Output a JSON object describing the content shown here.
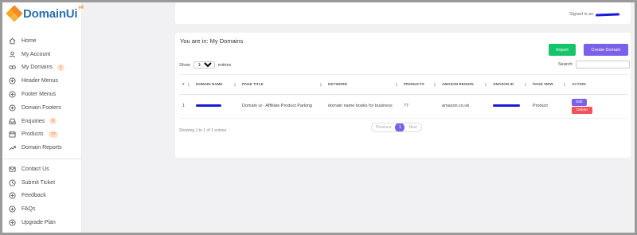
{
  "app": {
    "brand": "DomainUi",
    "brand_version": "v4",
    "colors": {
      "accent": "#7b61e8",
      "success": "#16c46b",
      "danger": "#f0535a",
      "brand_blue": "#2a6fb0",
      "brand_orange": "#f28c28"
    }
  },
  "sidebar": {
    "items": [
      {
        "label": "Home",
        "icon": "home-icon"
      },
      {
        "label": "My Account",
        "icon": "user-icon"
      },
      {
        "label": "My Domains",
        "icon": "link-icon",
        "badge": "1"
      },
      {
        "label": "Header Menus",
        "icon": "plus-circle-icon"
      },
      {
        "label": "Footer Menus",
        "icon": "plus-circle-icon"
      },
      {
        "label": "Domain Footers",
        "icon": "plus-circle-icon"
      },
      {
        "label": "Enquiries",
        "icon": "inbox-icon",
        "badge": "0"
      },
      {
        "label": "Products",
        "icon": "calendar-icon",
        "badge": "77"
      },
      {
        "label": "Domain Reports",
        "icon": "trend-icon"
      }
    ],
    "support_items": [
      {
        "label": "Contact Us",
        "icon": "mail-icon"
      },
      {
        "label": "Submit Ticket",
        "icon": "clock-icon"
      },
      {
        "label": "Feedback",
        "icon": "plus-circle-icon"
      },
      {
        "label": "FAQs",
        "icon": "plus-circle-icon"
      },
      {
        "label": "Upgrade Plan",
        "icon": "plus-circle-icon"
      }
    ]
  },
  "header": {
    "signed_in_label": "Signed is as"
  },
  "main": {
    "breadcrumb": "You are in: My Domains",
    "import_label": "Import",
    "create_label": "Create Domain",
    "show_label": "Show",
    "entries_value": "10",
    "entries_label": "entries",
    "search_label": "Search:",
    "search_value": "",
    "columns": [
      "#",
      "DOMAIN NAME",
      "PAGE TITLE",
      "KEYWORD",
      "PRODUCTS",
      "AMAZON REGION",
      "AMAZON ID",
      "PAGE VIEW",
      "ACTION"
    ],
    "rows": [
      {
        "index": "1",
        "page_title": "Domain ui - Affiliate Product Parking",
        "keyword": "domain name books for business",
        "products": "77",
        "region": "amazon.co.uk",
        "page_view": "Product",
        "edit_label": "Edit",
        "delete_label": "Delete"
      }
    ],
    "info": "Showing 1 to 1 of 1 entries",
    "pagination": {
      "previous": "Previous",
      "current": "1",
      "next": "Next"
    }
  }
}
